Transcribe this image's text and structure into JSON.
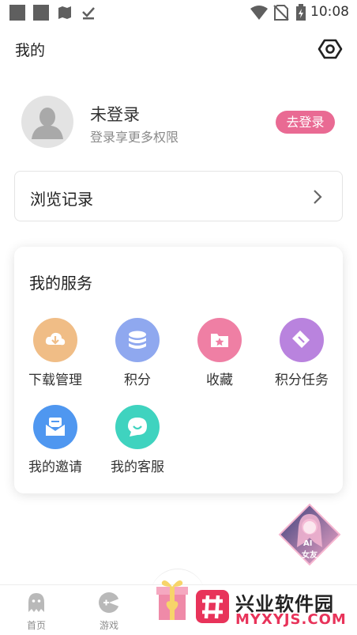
{
  "status_bar": {
    "time": "10:08"
  },
  "header": {
    "title": "我的"
  },
  "profile": {
    "name": "未登录",
    "subtitle": "登录享更多权限",
    "login_button": "去登录"
  },
  "history": {
    "label": "浏览记录"
  },
  "services": {
    "title": "我的服务",
    "items": [
      {
        "label": "下载管理",
        "icon": "download-icon",
        "color": "#f0bd86"
      },
      {
        "label": "积分",
        "icon": "coins-icon",
        "color": "#8fa8ef"
      },
      {
        "label": "收藏",
        "icon": "favorite-folder-icon",
        "color": "#ef7fa4"
      },
      {
        "label": "积分任务",
        "icon": "diamond-tag-icon",
        "color": "#b983de"
      },
      {
        "label": "我的邀请",
        "icon": "invite-mail-icon",
        "color": "#4f97f0"
      },
      {
        "label": "我的客服",
        "icon": "chat-bubble-icon",
        "color": "#3fd3bf"
      }
    ]
  },
  "ai_badge": {
    "line1": "AI",
    "line2": "女友"
  },
  "bottom_nav": {
    "items": [
      {
        "label": "首页"
      },
      {
        "label": "游戏"
      }
    ]
  },
  "watermark": {
    "brand": "兴业软件园",
    "url": "MYXYJS.COM"
  },
  "colors": {
    "accent": "#e96a93"
  }
}
